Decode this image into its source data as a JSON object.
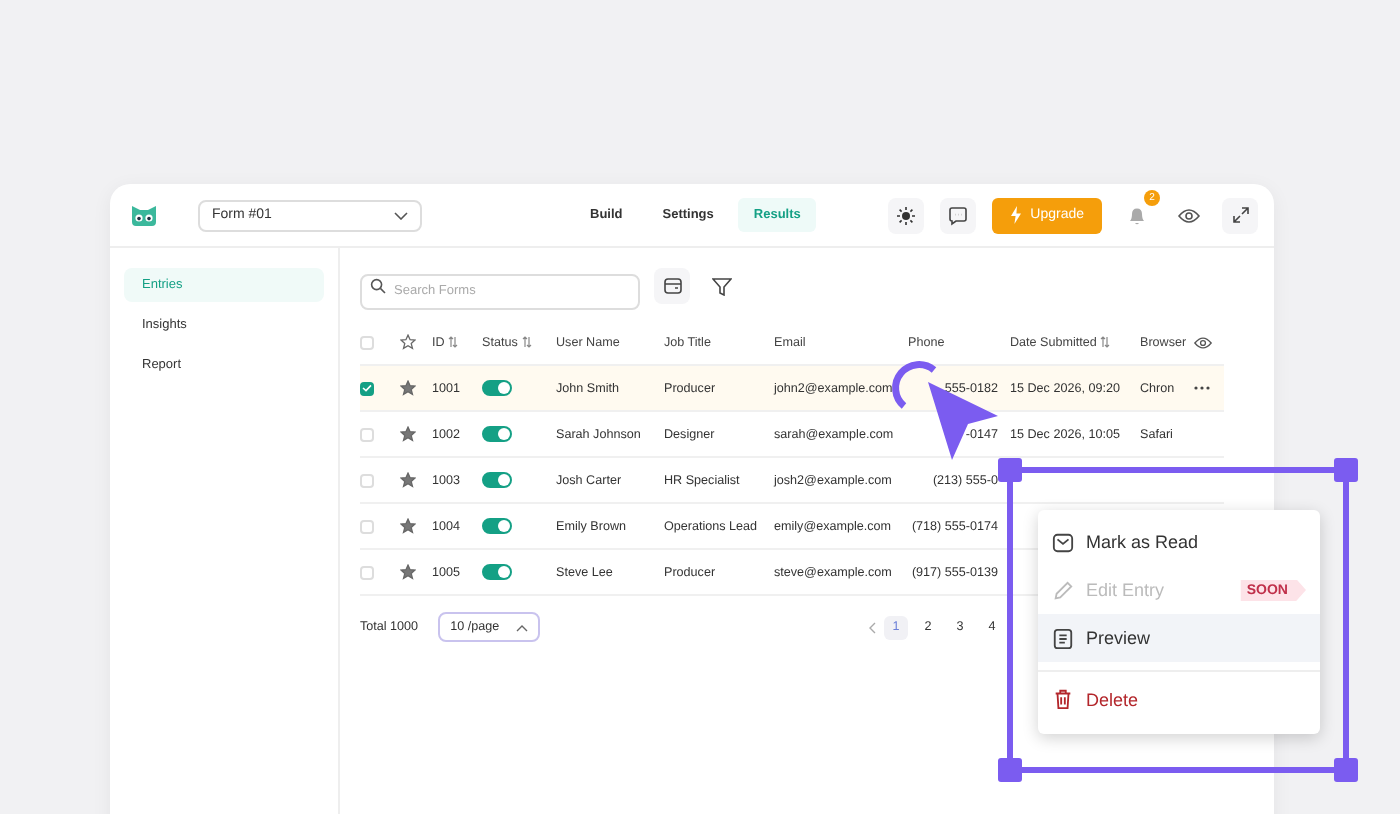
{
  "topbar": {
    "form_select": "Form #01",
    "tabs": [
      {
        "label": "Build",
        "selected": false
      },
      {
        "label": "Settings",
        "selected": false
      },
      {
        "label": "Results",
        "selected": true
      }
    ],
    "upgrade": "Upgrade",
    "notification_badge": "2"
  },
  "sidebar": {
    "items": [
      {
        "label": "Entries",
        "selected": true
      },
      {
        "label": "Insights",
        "selected": false
      },
      {
        "label": "Report",
        "selected": false
      }
    ]
  },
  "search": {
    "placeholder": "Search Forms"
  },
  "table": {
    "header_checked": false,
    "columns": [
      {
        "label": "ID",
        "sortable": true
      },
      {
        "label": "Status",
        "sortable": true
      },
      {
        "label": "User Name",
        "sortable": false
      },
      {
        "label": "Job Title",
        "sortable": false
      },
      {
        "label": "Email",
        "sortable": false
      },
      {
        "label": "Phone",
        "sortable": false
      },
      {
        "label": "Date Submitted",
        "sortable": true
      },
      {
        "label": "Browser",
        "sortable": false
      }
    ],
    "rows": [
      {
        "checked": true,
        "hovered": true,
        "id": "1001",
        "on": true,
        "name": "John  Smith",
        "job": "Producer",
        "email": "john2@example.com",
        "phone": "555-0182",
        "date": "15 Dec 2026, 09:20",
        "browser": "Chron",
        "show_actions": true
      },
      {
        "checked": false,
        "hovered": false,
        "id": "1002",
        "on": true,
        "name": "Sarah Johnson",
        "job": "Designer",
        "email": "sarah@example.com",
        "phone": "-0147",
        "date": "15 Dec 2026, 10:05",
        "browser": "Safari",
        "show_actions": false
      },
      {
        "checked": false,
        "hovered": false,
        "id": "1003",
        "on": true,
        "name": "Josh Carter",
        "job": "HR Specialist",
        "email": "josh2@example.com",
        "phone": "(213) 555-0",
        "show_actions": false
      },
      {
        "checked": false,
        "hovered": false,
        "id": "1004",
        "on": true,
        "name": "Emily Brown",
        "job": "Operations Lead",
        "email": "emily@example.com",
        "phone": "(718) 555-0174",
        "show_actions": false
      },
      {
        "checked": false,
        "hovered": false,
        "id": "1005",
        "on": true,
        "name": "Steve Lee",
        "job": "Producer",
        "email": "steve@example.com",
        "phone": "(917) 555-0139",
        "show_actions": false
      }
    ]
  },
  "footer": {
    "total": "Total 1000",
    "page_size": "10 /page",
    "pages": [
      {
        "label": "1",
        "selected": true
      },
      {
        "label": "2",
        "selected": false
      },
      {
        "label": "3",
        "selected": false
      },
      {
        "label": "4",
        "selected": false
      }
    ]
  },
  "context_menu": {
    "items": [
      {
        "kind": "mark-read",
        "label": "Mark as Read",
        "disabled": false,
        "selected": false
      },
      {
        "kind": "edit",
        "label": "Edit Entry",
        "disabled": true,
        "selected": false,
        "badge": "SOON"
      },
      {
        "kind": "preview",
        "label": "Preview",
        "disabled": false,
        "selected": true
      },
      {
        "kind": "delete",
        "label": "Delete",
        "disabled": false,
        "selected": false
      }
    ]
  }
}
